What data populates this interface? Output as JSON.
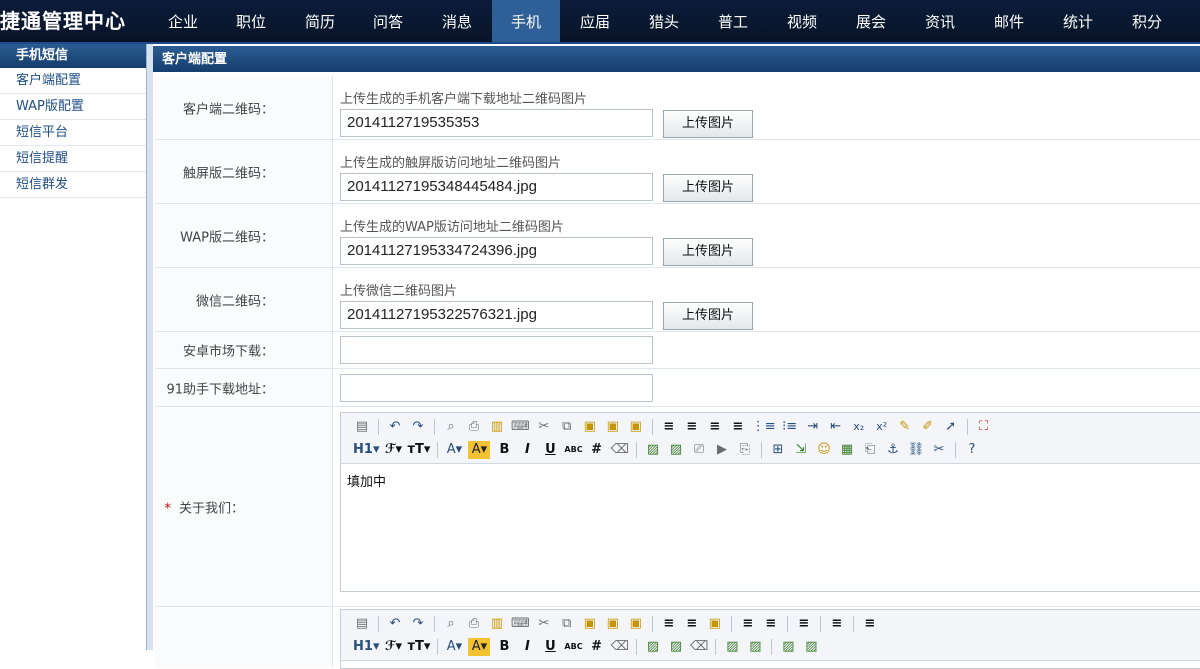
{
  "app_title": "捷通管理中心",
  "nav": {
    "items": [
      "企业",
      "职位",
      "简历",
      "问答",
      "消息",
      "手机",
      "应届",
      "猎头",
      "普工",
      "视频",
      "展会",
      "资讯",
      "邮件",
      "统计",
      "积分"
    ],
    "active_index": 5
  },
  "sidebar": {
    "header": "手机短信",
    "items": [
      "客户端配置",
      "WAP版配置",
      "短信平台",
      "短信提醒",
      "短信群发"
    ]
  },
  "panel": {
    "title": "客户端配置",
    "fields": {
      "client_qr": {
        "label": "客户端二维码：",
        "hint": "上传生成的手机客户端下载地址二维码图片",
        "value": "2014112719535353",
        "button": "上传图片"
      },
      "touch_qr": {
        "label": "触屏版二维码：",
        "hint": "上传生成的触屏版访问地址二维码图片",
        "value": "20141127195348445484.jpg",
        "button": "上传图片"
      },
      "wap_qr": {
        "label": "WAP版二维码：",
        "hint": "上传生成的WAP版访问地址二维码图片",
        "value": "20141127195334724396.jpg",
        "button": "上传图片"
      },
      "wechat_qr": {
        "label": "微信二维码：",
        "hint": "上传微信二维码图片",
        "value": "20141127195322576321.jpg",
        "button": "上传图片"
      },
      "android_market": {
        "label": "安卓市场下载：",
        "value": ""
      },
      "assistant91": {
        "label": "91助手下载地址：",
        "value": ""
      },
      "about_us": {
        "required_mark": "*",
        "label": "关于我们：",
        "content": "填加中"
      }
    },
    "editor_toolbar": {
      "heading": "H1",
      "font_family": "ℱ",
      "font_size": "тT",
      "font_color": "A",
      "highlight": "A",
      "bold": "B",
      "italic": "I",
      "underline": "U",
      "strike": "ABC"
    }
  }
}
